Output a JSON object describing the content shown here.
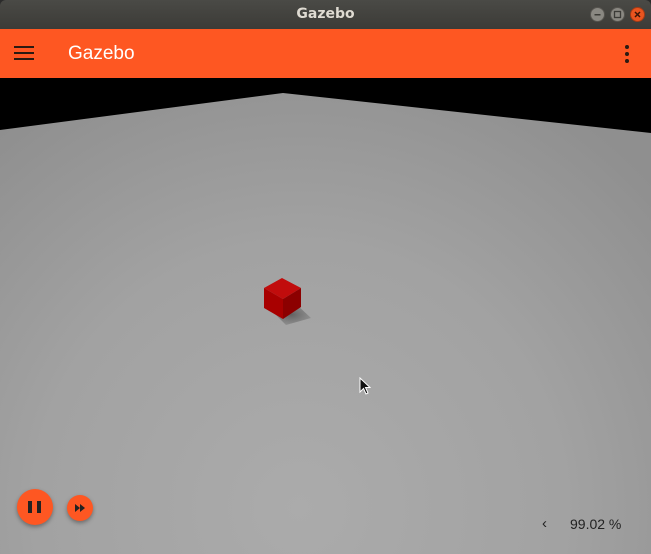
{
  "window": {
    "title": "Gazebo"
  },
  "toolbar": {
    "title": "Gazebo",
    "menu_icon": "hamburger-menu-icon",
    "more_icon": "more-vertical-icon",
    "accent_color": "#fe5722"
  },
  "scene": {
    "ground_color": "#a4a4a4",
    "sky_color": "#000000",
    "objects": [
      {
        "name": "box",
        "color": "#b00000"
      }
    ]
  },
  "playback": {
    "state": "playing",
    "pause_icon": "pause-icon",
    "step_icon": "fast-forward-icon"
  },
  "real_time_factor": {
    "toggle_icon": "chevron-left-icon",
    "toggle_label": "‹",
    "value": "99.02 %"
  }
}
